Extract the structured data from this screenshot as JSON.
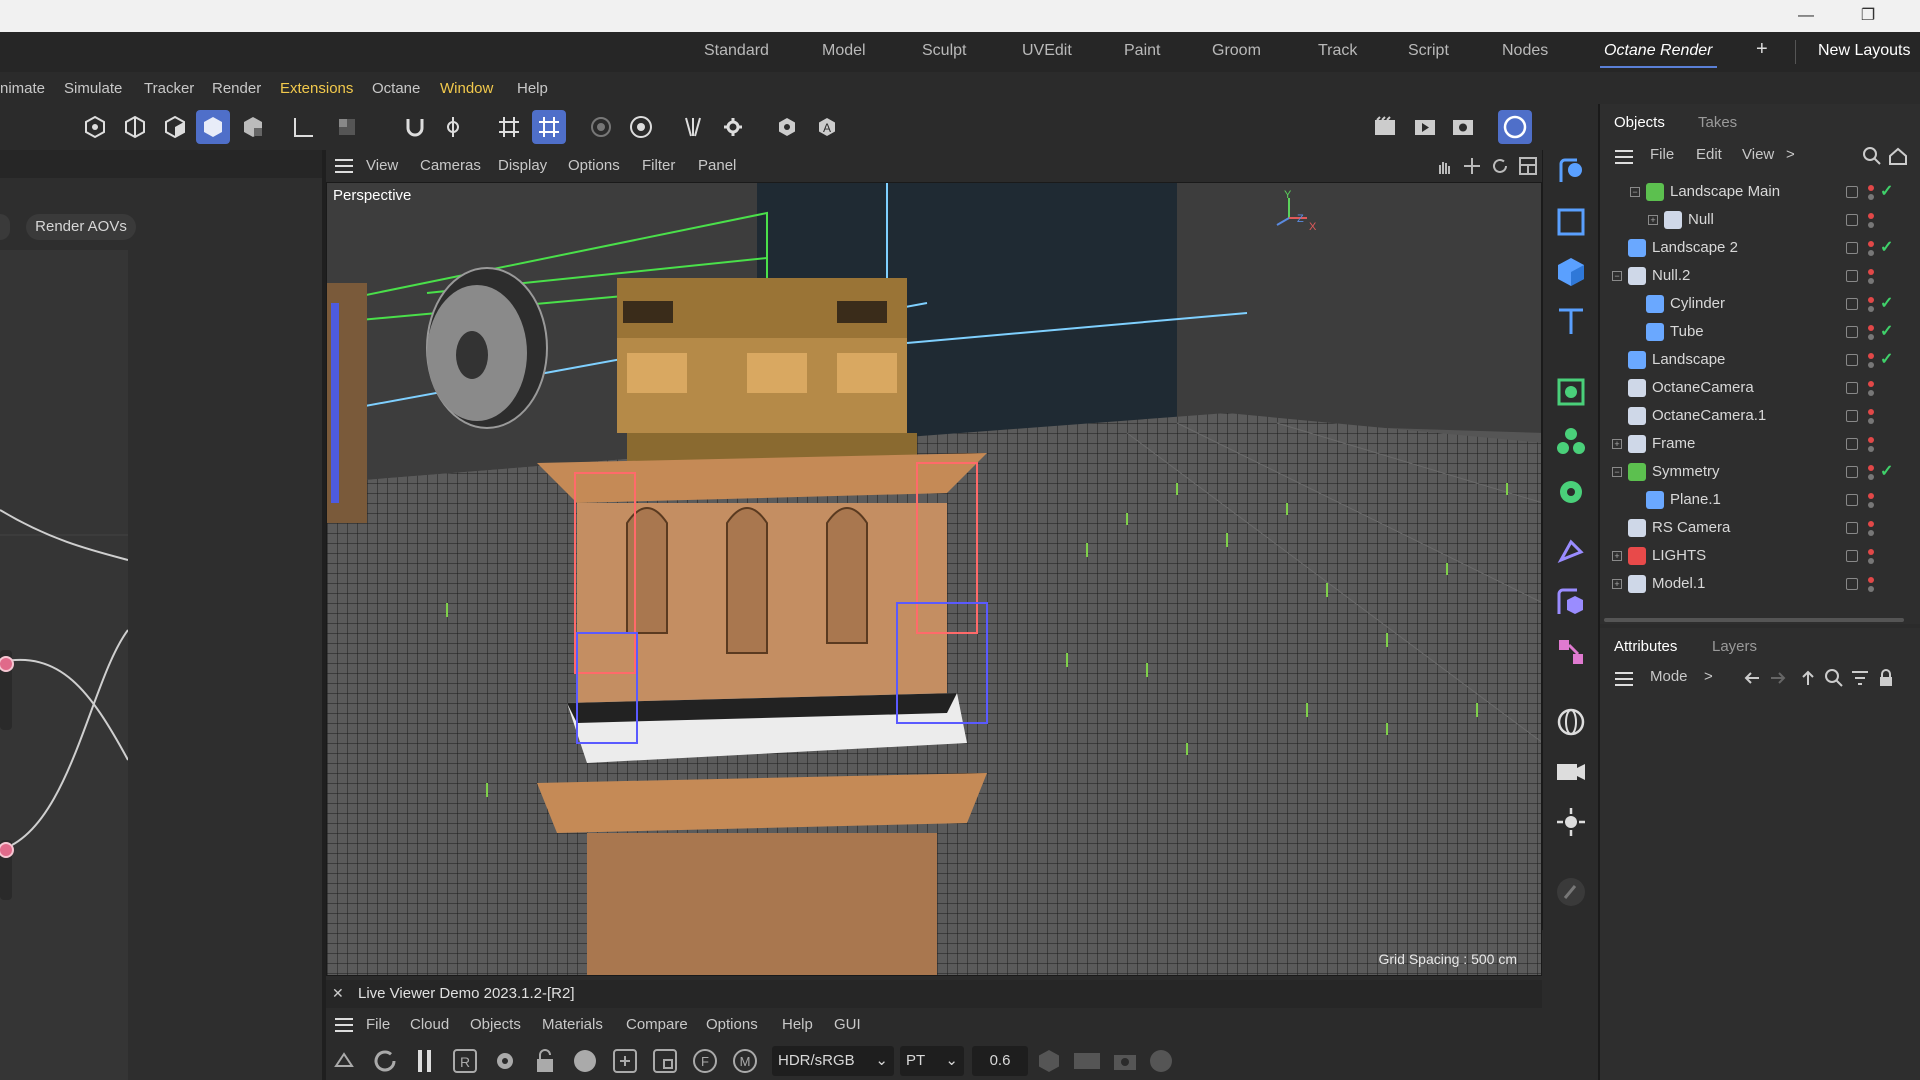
{
  "title_bar": {
    "minimize": "—",
    "restore": "❐"
  },
  "layouts": {
    "tabs": [
      "Standard",
      "Model",
      "Sculpt",
      "UVEdit",
      "Paint",
      "Groom",
      "Track",
      "Script",
      "Nodes",
      "Octane Render"
    ],
    "active": "Octane Render",
    "add": "+",
    "new_layouts": "New Layouts"
  },
  "menu": [
    "nimate",
    "Simulate",
    "Tracker",
    "Render",
    "Extensions",
    "Octane",
    "Window",
    "Help"
  ],
  "menu_highlight": [
    "Extensions",
    "Window"
  ],
  "left_panel": {
    "render_aovs": "Render AOVs"
  },
  "viewport": {
    "menu": [
      "View",
      "Cameras",
      "Display",
      "Options",
      "Filter",
      "Panel"
    ],
    "label": "Perspective",
    "grid_spacing": "Grid Spacing : 500 cm",
    "axis": {
      "y": "Y",
      "z": "Z",
      "x": "X"
    }
  },
  "live_viewer": {
    "close": "✕",
    "title": "Live Viewer Demo 2023.1.2-[R2]",
    "menu": [
      "File",
      "Cloud",
      "Objects",
      "Materials",
      "Compare",
      "Options",
      "Help",
      "GUI"
    ],
    "color_space": "HDR/sRGB",
    "kernel": "PT",
    "value": "0.6"
  },
  "objects_panel": {
    "tabs": [
      "Objects",
      "Takes"
    ],
    "active_tab": "Objects",
    "menu": [
      "File",
      "Edit",
      "View"
    ],
    "more": ">",
    "items": [
      {
        "name": "Landscape Main",
        "indent": 1,
        "icon": "landscape-main-icon",
        "expander": "−",
        "check": true,
        "color": "#5cc04f"
      },
      {
        "name": "Null",
        "indent": 2,
        "icon": "null-icon",
        "expander": "+",
        "check": false,
        "color": "#cfd8e8"
      },
      {
        "name": "Landscape 2",
        "indent": 0,
        "icon": "landscape-icon",
        "expander": "",
        "check": true,
        "color": "#6aa8ff"
      },
      {
        "name": "Null.2",
        "indent": 0,
        "icon": "null-icon",
        "expander": "−",
        "check": false,
        "color": "#cfd8e8"
      },
      {
        "name": "Cylinder",
        "indent": 1,
        "icon": "cylinder-icon",
        "expander": "",
        "check": true,
        "color": "#6aa8ff"
      },
      {
        "name": "Tube",
        "indent": 1,
        "icon": "tube-icon",
        "expander": "",
        "check": true,
        "color": "#6aa8ff"
      },
      {
        "name": "Landscape",
        "indent": 0,
        "icon": "landscape-icon",
        "expander": "",
        "check": true,
        "color": "#6aa8ff"
      },
      {
        "name": "OctaneCamera",
        "indent": 0,
        "icon": "camera-icon",
        "expander": "",
        "check": false,
        "color": "#cfd8e8"
      },
      {
        "name": "OctaneCamera.1",
        "indent": 0,
        "icon": "camera-icon",
        "expander": "",
        "check": false,
        "color": "#cfd8e8"
      },
      {
        "name": "Frame",
        "indent": 0,
        "icon": "null-icon",
        "expander": "+",
        "check": false,
        "color": "#cfd8e8"
      },
      {
        "name": "Symmetry",
        "indent": 0,
        "icon": "symmetry-icon",
        "expander": "−",
        "check": true,
        "color": "#5cc04f"
      },
      {
        "name": "Plane.1",
        "indent": 1,
        "icon": "plane-icon",
        "expander": "",
        "check": false,
        "color": "#6aa8ff"
      },
      {
        "name": "RS Camera",
        "indent": 0,
        "icon": "camera-icon",
        "expander": "",
        "check": false,
        "color": "#cfd8e8"
      },
      {
        "name": "LIGHTS",
        "indent": 0,
        "icon": "lights-icon",
        "expander": "+",
        "check": false,
        "color": "#e84a4a"
      },
      {
        "name": "Model.1",
        "indent": 0,
        "icon": "null-icon",
        "expander": "+",
        "check": false,
        "color": "#cfd8e8"
      }
    ]
  },
  "attributes_panel": {
    "tabs": [
      "Attributes",
      "Layers"
    ],
    "active_tab": "Attributes",
    "mode": "Mode",
    "more": ">"
  }
}
